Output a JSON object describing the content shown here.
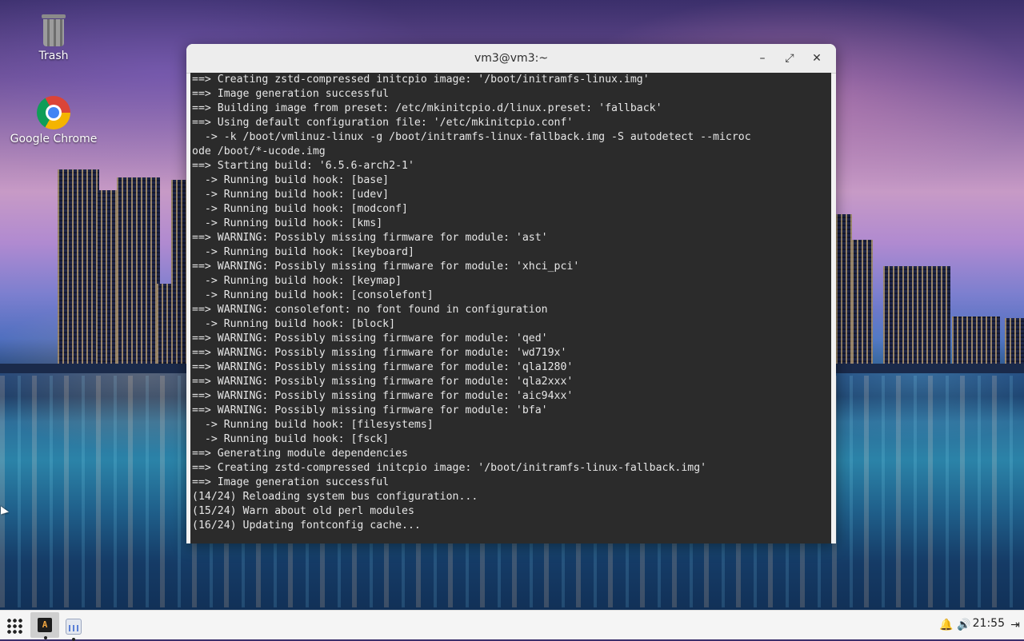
{
  "desktop": {
    "icons": [
      {
        "label": "Trash",
        "icon": "trash-icon"
      },
      {
        "label": "Google Chrome",
        "icon": "chrome-icon"
      }
    ]
  },
  "window": {
    "title": "vm3@vm3:~",
    "buttons": {
      "minimize": "–",
      "maximize": "⤢",
      "close": "✕"
    }
  },
  "terminal": {
    "lines": [
      "==> Creating zstd-compressed initcpio image: '/boot/initramfs-linux.img'",
      "==> Image generation successful",
      "==> Building image from preset: /etc/mkinitcpio.d/linux.preset: 'fallback'",
      "==> Using default configuration file: '/etc/mkinitcpio.conf'",
      "  -> -k /boot/vmlinuz-linux -g /boot/initramfs-linux-fallback.img -S autodetect --microc",
      "ode /boot/*-ucode.img",
      "==> Starting build: '6.5.6-arch2-1'",
      "  -> Running build hook: [base]",
      "  -> Running build hook: [udev]",
      "  -> Running build hook: [modconf]",
      "  -> Running build hook: [kms]",
      "==> WARNING: Possibly missing firmware for module: 'ast'",
      "  -> Running build hook: [keyboard]",
      "==> WARNING: Possibly missing firmware for module: 'xhci_pci'",
      "  -> Running build hook: [keymap]",
      "  -> Running build hook: [consolefont]",
      "==> WARNING: consolefont: no font found in configuration",
      "  -> Running build hook: [block]",
      "==> WARNING: Possibly missing firmware for module: 'qed'",
      "==> WARNING: Possibly missing firmware for module: 'wd719x'",
      "==> WARNING: Possibly missing firmware for module: 'qla1280'",
      "==> WARNING: Possibly missing firmware for module: 'qla2xxx'",
      "==> WARNING: Possibly missing firmware for module: 'aic94xx'",
      "==> WARNING: Possibly missing firmware for module: 'bfa'",
      "  -> Running build hook: [filesystems]",
      "  -> Running build hook: [fsck]",
      "==> Generating module dependencies",
      "==> Creating zstd-compressed initcpio image: '/boot/initramfs-linux-fallback.img'",
      "==> Image generation successful",
      "(14/24) Reloading system bus configuration...",
      "(15/24) Warn about old perl modules",
      "(16/24) Updating fontconfig cache..."
    ]
  },
  "taskbar": {
    "apps_icon": "apps-grid-icon",
    "tasks": [
      {
        "name": "terminal",
        "icon": "terminal-icon",
        "glyph": "A"
      },
      {
        "name": "system-monitor",
        "icon": "system-monitor-icon"
      }
    ],
    "tray": {
      "notifications_icon": "🔔",
      "volume_icon": "🔊",
      "clock": "21:55",
      "logout_icon": "⇥"
    }
  }
}
